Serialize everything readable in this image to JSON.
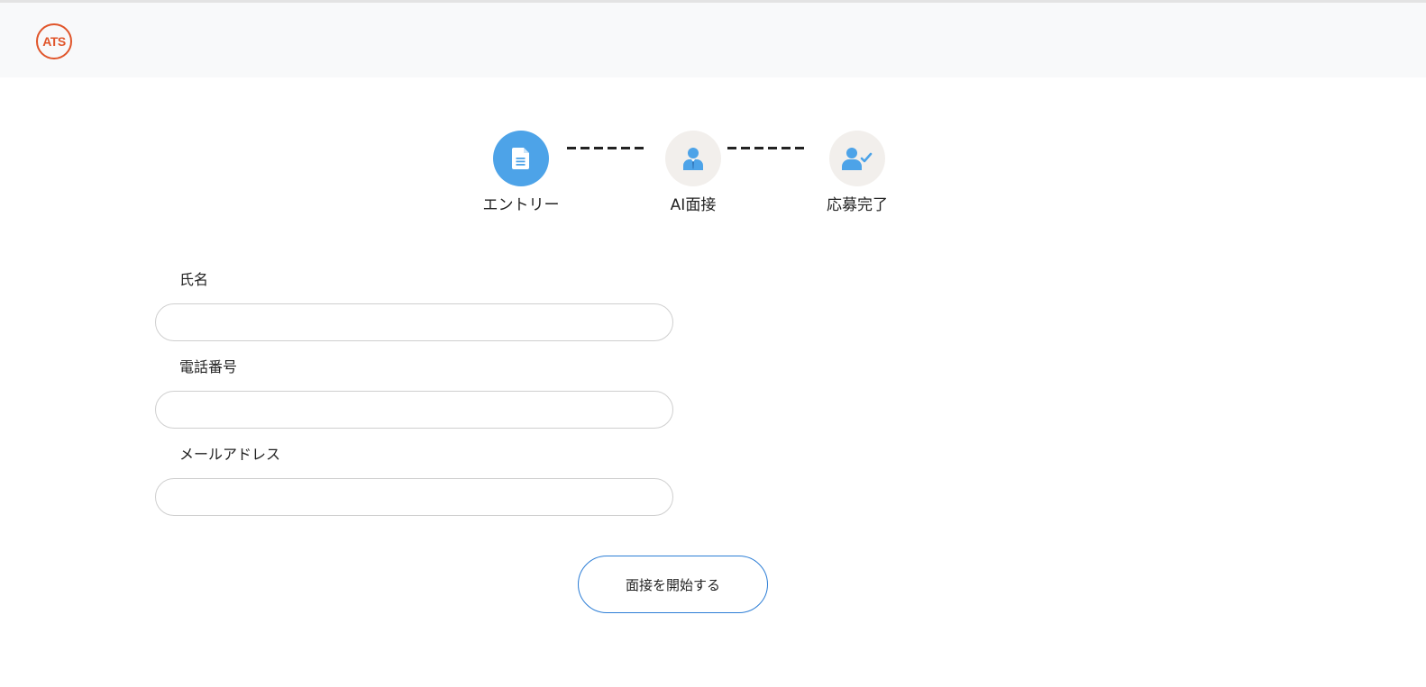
{
  "header": {
    "logo_text": "ATS",
    "logo_color": "#e0552a"
  },
  "stepper": {
    "steps": [
      {
        "label": "エントリー",
        "icon": "document-icon",
        "state": "active"
      },
      {
        "label": "AI面接",
        "icon": "interviewer-icon",
        "state": "inactive"
      },
      {
        "label": "応募完了",
        "icon": "user-check-icon",
        "state": "inactive"
      }
    ],
    "active_color": "#4da3e8",
    "inactive_color": "#f2efec"
  },
  "form": {
    "name_label": "氏名",
    "name_value": "",
    "phone_label": "電話番号",
    "phone_value": "",
    "email_label": "メールアドレス",
    "email_value": "",
    "submit_label": "面接を開始する"
  }
}
